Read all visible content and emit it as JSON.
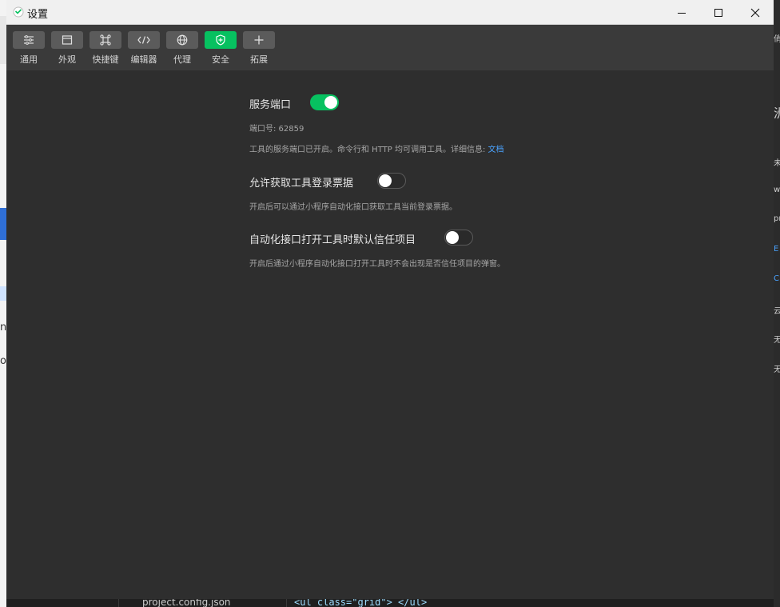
{
  "window": {
    "title": "设置",
    "controls": {
      "minimize": "minimize-icon",
      "maximize": "maximize-icon",
      "close": "close-icon"
    }
  },
  "toolbar": {
    "items": [
      {
        "label": "通用",
        "icon": "general-icon",
        "active": false
      },
      {
        "label": "外观",
        "icon": "appearance-icon",
        "active": false
      },
      {
        "label": "快捷键",
        "icon": "shortcut-icon",
        "active": false
      },
      {
        "label": "编辑器",
        "icon": "editor-icon",
        "active": false
      },
      {
        "label": "代理",
        "icon": "proxy-icon",
        "active": false
      },
      {
        "label": "安全",
        "icon": "security-icon",
        "active": true
      },
      {
        "label": "拓展",
        "icon": "extension-icon",
        "active": false
      }
    ]
  },
  "settings": {
    "service_port": {
      "title": "服务端口",
      "enabled": true,
      "port_label": "端口号: 62859",
      "desc": "工具的服务端口已开启。命令行和 HTTP 均可调用工具。详细信息:",
      "link": "文档"
    },
    "login_ticket": {
      "title": "允许获取工具登录票据",
      "enabled": false,
      "desc": "开启后可以通过小程序自动化接口获取工具当前登录票据。"
    },
    "trust_project": {
      "title": "自动化接口打开工具时默认信任项目",
      "enabled": false,
      "desc": "开启后通过小程序自动化接口打开工具时不会出现是否信任项目的弹窗。"
    }
  },
  "background": {
    "file_name": "project.config.json",
    "code_snippet": "<ul class=\"grid\"> </ul>"
  },
  "colors": {
    "accent": "#07c160",
    "link": "#4aa3ff",
    "toolbar_bg": "#3a3a3a",
    "content_bg": "#2e2e2e"
  }
}
